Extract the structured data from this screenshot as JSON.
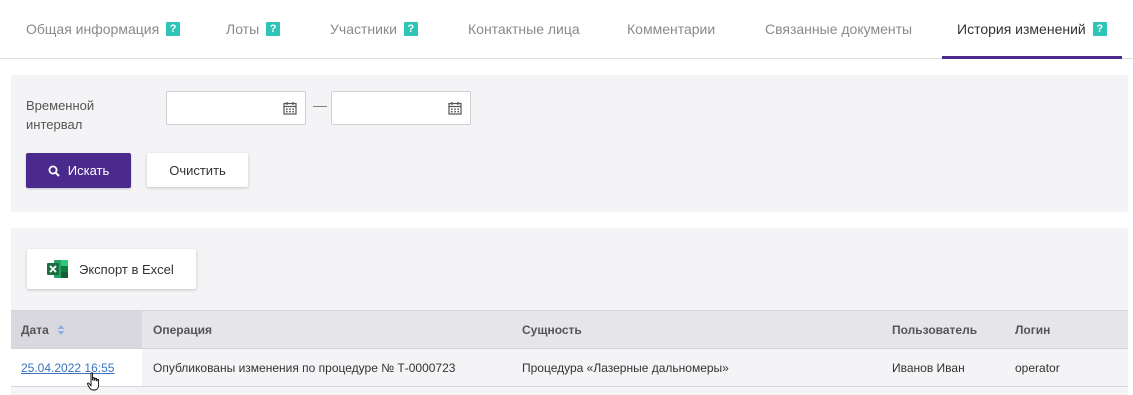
{
  "tabs": [
    {
      "label": "Общая информация",
      "help": true
    },
    {
      "label": "Лоты",
      "help": true
    },
    {
      "label": "Участники",
      "help": true
    },
    {
      "label": "Контактные лица",
      "help": false
    },
    {
      "label": "Комментарии",
      "help": false
    },
    {
      "label": "Связанные документы",
      "help": false
    },
    {
      "label": "История изменений",
      "help": true,
      "active": true
    }
  ],
  "help_glyph": "?",
  "filter": {
    "label": "Временной интервал",
    "date_from": "",
    "date_to": "",
    "dash": "—",
    "search_label": "Искать",
    "clear_label": "Очистить"
  },
  "results": {
    "export_label": "Экспорт в Excel",
    "columns": [
      "Дата",
      "Операция",
      "Сущность",
      "Пользователь",
      "Логин"
    ],
    "rows": [
      {
        "date": "25.04.2022 16:55",
        "operation": "Опубликованы изменения по процедуре № Т-0000723",
        "entity": "Процедура «Лазерные дальномеры»",
        "user": "Иванов Иван",
        "login": "operator"
      }
    ]
  },
  "colors": {
    "accent": "#4b2a8e",
    "help_badge": "#2ec4b6",
    "link": "#3b73c0",
    "excel_green": "#1d6f42"
  },
  "icons": {
    "help": "help-icon",
    "calendar": "calendar-icon",
    "search": "search-icon",
    "excel": "excel-icon",
    "sort": "sort-icon",
    "cursor": "hand-cursor-icon"
  }
}
